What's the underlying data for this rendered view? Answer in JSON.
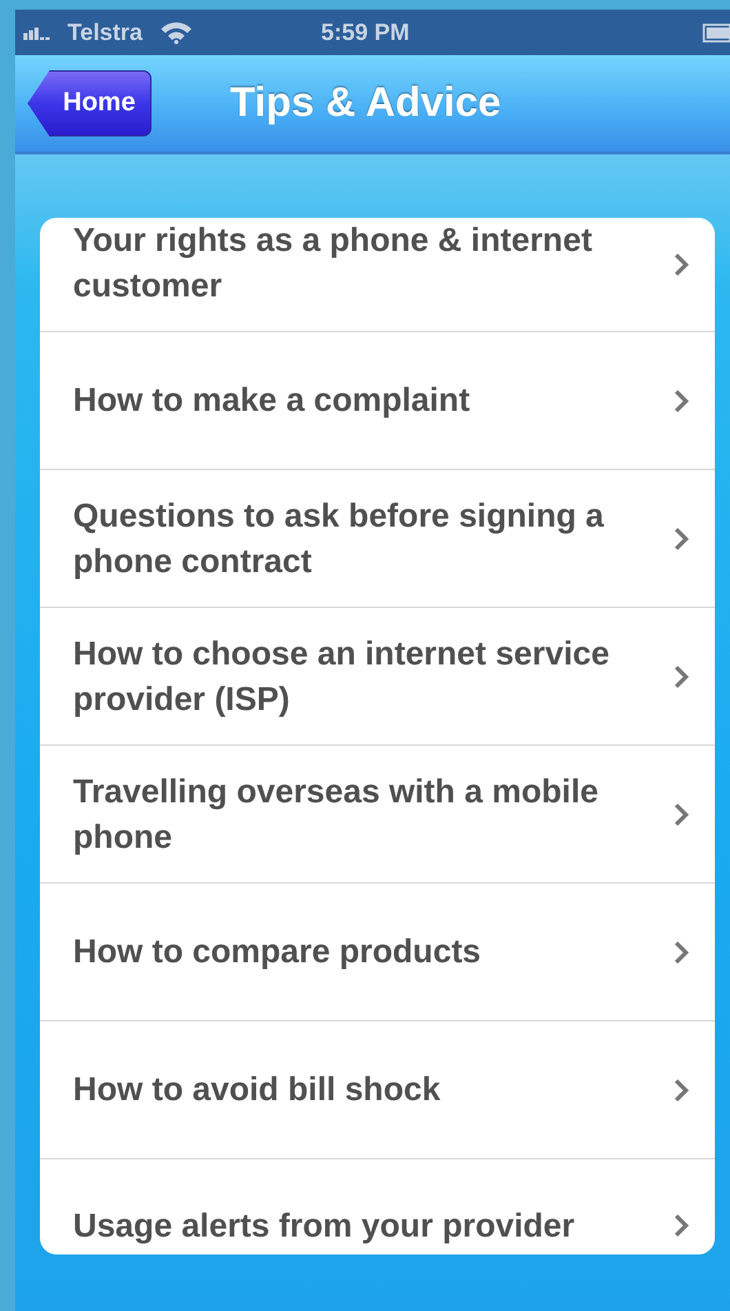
{
  "status_bar": {
    "carrier": "Telstra",
    "time": "5:59 PM"
  },
  "nav_bar": {
    "back_button": "Home",
    "title": "Tips & Advice"
  },
  "items": [
    {
      "label": "Your rights as a phone & internet customer"
    },
    {
      "label": "How to make a complaint"
    },
    {
      "label": "Questions to ask before signing a phone contract"
    },
    {
      "label": "How to choose an internet service provider (ISP)"
    },
    {
      "label": "Travelling overseas with a mobile phone"
    },
    {
      "label": "How to compare products"
    },
    {
      "label": "How to avoid bill shock"
    },
    {
      "label": "Usage alerts from your provider"
    }
  ]
}
